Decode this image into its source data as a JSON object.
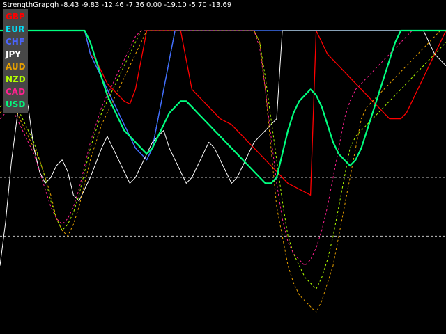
{
  "chart_data": {
    "type": "line",
    "title": "StrengthGrapgh -8.43 -9.83 -12.46 -7.36 0.00 -19.10 -5.70 -13.69",
    "x": [
      0,
      1,
      2,
      3,
      4,
      5,
      6,
      7,
      8,
      9,
      10,
      11,
      12,
      13,
      14,
      15,
      16,
      17,
      18,
      19,
      20,
      21,
      22,
      23,
      24,
      25,
      26,
      27,
      28,
      29,
      30,
      31,
      32,
      33,
      34,
      35,
      36,
      37,
      38,
      39,
      40,
      41,
      42,
      43,
      44,
      45,
      46,
      47,
      48,
      49,
      50,
      51,
      52,
      53,
      54,
      55,
      56,
      57,
      58,
      59,
      60,
      61,
      62,
      63,
      64,
      65,
      66,
      67,
      68,
      69,
      70,
      71,
      72,
      73,
      74,
      75,
      76,
      77,
      78,
      79
    ],
    "ylim": [
      0,
      100
    ],
    "reference_lines": [
      {
        "y": 50,
        "color": "#c0c0c0",
        "style": "dashed"
      },
      {
        "y": 30,
        "color": "#c0c0c0",
        "style": "dashed"
      }
    ],
    "series": [
      {
        "name": "GBP",
        "color": "#ff0000",
        "style": "solid",
        "width": 1.3,
        "values": [
          100,
          100,
          100,
          100,
          100,
          100,
          100,
          100,
          100,
          100,
          100,
          100,
          100,
          100,
          100,
          100,
          92,
          90,
          86,
          82,
          80,
          78,
          76,
          75,
          80,
          90,
          100,
          100,
          100,
          100,
          100,
          100,
          100,
          90,
          80,
          78,
          76,
          74,
          72,
          70,
          69,
          68,
          66,
          64,
          62,
          60,
          58,
          56,
          54,
          52,
          50,
          48,
          47,
          46,
          45,
          44,
          100,
          96,
          92,
          90,
          88,
          86,
          84,
          82,
          80,
          78,
          76,
          74,
          72,
          70,
          70,
          70,
          72,
          76,
          80,
          84,
          88,
          92,
          96,
          100
        ]
      },
      {
        "name": "EUR",
        "color": "#00e5ff",
        "style": "solid",
        "width": 1.3,
        "values": [
          100,
          100,
          100,
          100,
          100,
          100,
          100,
          100,
          100,
          100,
          100,
          100,
          100,
          100,
          100,
          100,
          92,
          88,
          84,
          80,
          76,
          72,
          68,
          64,
          60,
          58,
          56,
          60,
          70,
          80,
          90,
          100,
          100,
          100,
          100,
          100,
          100,
          100,
          100,
          100,
          100,
          100,
          100,
          100,
          100,
          100,
          100,
          100,
          100,
          100,
          100,
          100,
          100,
          100,
          100,
          100,
          100,
          100,
          100,
          100,
          100,
          100,
          100,
          100,
          100,
          100,
          100,
          100,
          100,
          100,
          100,
          100,
          100,
          100,
          100,
          100,
          100,
          100,
          100,
          100
        ]
      },
      {
        "name": "CHF",
        "color": "#4a64ff",
        "style": "solid",
        "width": 1.3,
        "values": [
          100,
          100,
          100,
          100,
          100,
          100,
          100,
          100,
          100,
          100,
          100,
          100,
          100,
          100,
          100,
          100,
          92,
          88,
          84,
          80,
          76,
          72,
          68,
          64,
          60,
          58,
          56,
          60,
          70,
          80,
          90,
          100,
          100,
          100,
          100,
          100,
          100,
          100,
          100,
          100,
          100,
          100,
          100,
          100,
          100,
          100,
          100,
          100,
          100,
          100,
          100,
          100,
          100,
          100,
          100,
          100,
          100,
          100,
          100,
          100,
          100,
          100,
          100,
          100,
          100,
          100,
          100,
          100,
          100,
          100,
          100,
          100,
          100,
          100,
          100,
          100,
          100,
          100,
          100,
          100
        ]
      },
      {
        "name": "JPY",
        "color": "#ffffff",
        "style": "solid",
        "width": 1.0,
        "values": [
          20,
          35,
          55,
          70,
          82,
          74,
          60,
          52,
          48,
          50,
          54,
          56,
          52,
          44,
          42,
          46,
          50,
          55,
          60,
          64,
          60,
          56,
          52,
          48,
          50,
          54,
          58,
          62,
          64,
          66,
          60,
          56,
          52,
          48,
          50,
          54,
          58,
          62,
          60,
          56,
          52,
          48,
          50,
          54,
          58,
          62,
          64,
          66,
          68,
          70,
          100,
          100,
          100,
          100,
          100,
          100,
          100,
          100,
          100,
          100,
          100,
          100,
          100,
          100,
          100,
          100,
          100,
          100,
          100,
          100,
          100,
          100,
          100,
          100,
          100,
          100,
          96,
          92,
          90,
          88
        ]
      },
      {
        "name": "AUD",
        "color": "#e8a000",
        "style": "dashed",
        "width": 1.0,
        "values": [
          72,
          74,
          76,
          72,
          68,
          64,
          60,
          56,
          50,
          44,
          36,
          32,
          30,
          34,
          40,
          48,
          56,
          62,
          68,
          72,
          76,
          80,
          84,
          88,
          92,
          96,
          100,
          100,
          100,
          100,
          100,
          100,
          100,
          100,
          100,
          100,
          100,
          100,
          100,
          100,
          100,
          100,
          100,
          100,
          100,
          100,
          96,
          80,
          60,
          40,
          30,
          20,
          14,
          10,
          8,
          6,
          4,
          8,
          14,
          20,
          30,
          40,
          50,
          60,
          70,
          74,
          76,
          78,
          80,
          82,
          84,
          86,
          88,
          90,
          92,
          94,
          96,
          98,
          100,
          100
        ]
      },
      {
        "name": "NZD",
        "color": "#b0ff00",
        "style": "dashed",
        "width": 1.0,
        "values": [
          74,
          76,
          78,
          74,
          70,
          66,
          62,
          56,
          50,
          42,
          36,
          32,
          34,
          38,
          44,
          52,
          60,
          66,
          72,
          76,
          80,
          84,
          88,
          92,
          96,
          100,
          100,
          100,
          100,
          100,
          100,
          100,
          100,
          100,
          100,
          100,
          100,
          100,
          100,
          100,
          100,
          100,
          100,
          100,
          100,
          100,
          96,
          84,
          70,
          56,
          42,
          30,
          24,
          20,
          16,
          14,
          12,
          16,
          22,
          30,
          40,
          50,
          60,
          64,
          66,
          68,
          70,
          72,
          74,
          76,
          78,
          80,
          82,
          84,
          86,
          88,
          90,
          92,
          94,
          96
        ]
      },
      {
        "name": "CAD",
        "color": "#ff2090",
        "style": "dashed",
        "width": 1.0,
        "values": [
          70,
          72,
          74,
          70,
          66,
          62,
          58,
          52,
          46,
          40,
          36,
          34,
          36,
          40,
          46,
          54,
          62,
          68,
          74,
          78,
          82,
          86,
          90,
          94,
          98,
          100,
          100,
          100,
          100,
          100,
          100,
          100,
          100,
          100,
          100,
          100,
          100,
          100,
          100,
          100,
          100,
          100,
          100,
          100,
          100,
          100,
          94,
          80,
          64,
          48,
          36,
          28,
          24,
          22,
          20,
          22,
          26,
          32,
          40,
          50,
          60,
          70,
          76,
          80,
          82,
          84,
          86,
          88,
          90,
          92,
          94,
          96,
          98,
          100,
          100,
          100,
          100,
          100,
          100,
          100
        ]
      },
      {
        "name": "USD",
        "color": "#00ff7f",
        "style": "solid",
        "width": 2.2,
        "values": [
          100,
          100,
          100,
          100,
          100,
          100,
          100,
          100,
          100,
          100,
          100,
          100,
          100,
          100,
          100,
          100,
          96,
          90,
          84,
          78,
          74,
          70,
          66,
          64,
          62,
          60,
          58,
          60,
          64,
          68,
          72,
          74,
          76,
          76,
          74,
          72,
          70,
          68,
          66,
          64,
          62,
          60,
          58,
          56,
          54,
          52,
          50,
          48,
          48,
          50,
          58,
          66,
          72,
          76,
          78,
          80,
          78,
          74,
          68,
          62,
          58,
          56,
          54,
          56,
          60,
          66,
          72,
          78,
          84,
          90,
          96,
          100,
          100,
          100,
          100,
          100,
          100,
          100,
          100,
          100
        ]
      }
    ]
  },
  "legend": {
    "items": [
      {
        "label": "GBP",
        "color": "#ff0000"
      },
      {
        "label": "EUR",
        "color": "#00e5ff"
      },
      {
        "label": "CHF",
        "color": "#4a64ff"
      },
      {
        "label": "JPY",
        "color": "#ffffff"
      },
      {
        "label": "AUD",
        "color": "#e8a000"
      },
      {
        "label": "NZD",
        "color": "#b0ff00"
      },
      {
        "label": "CAD",
        "color": "#ff2090"
      },
      {
        "label": "USD",
        "color": "#00ff7f"
      }
    ]
  }
}
